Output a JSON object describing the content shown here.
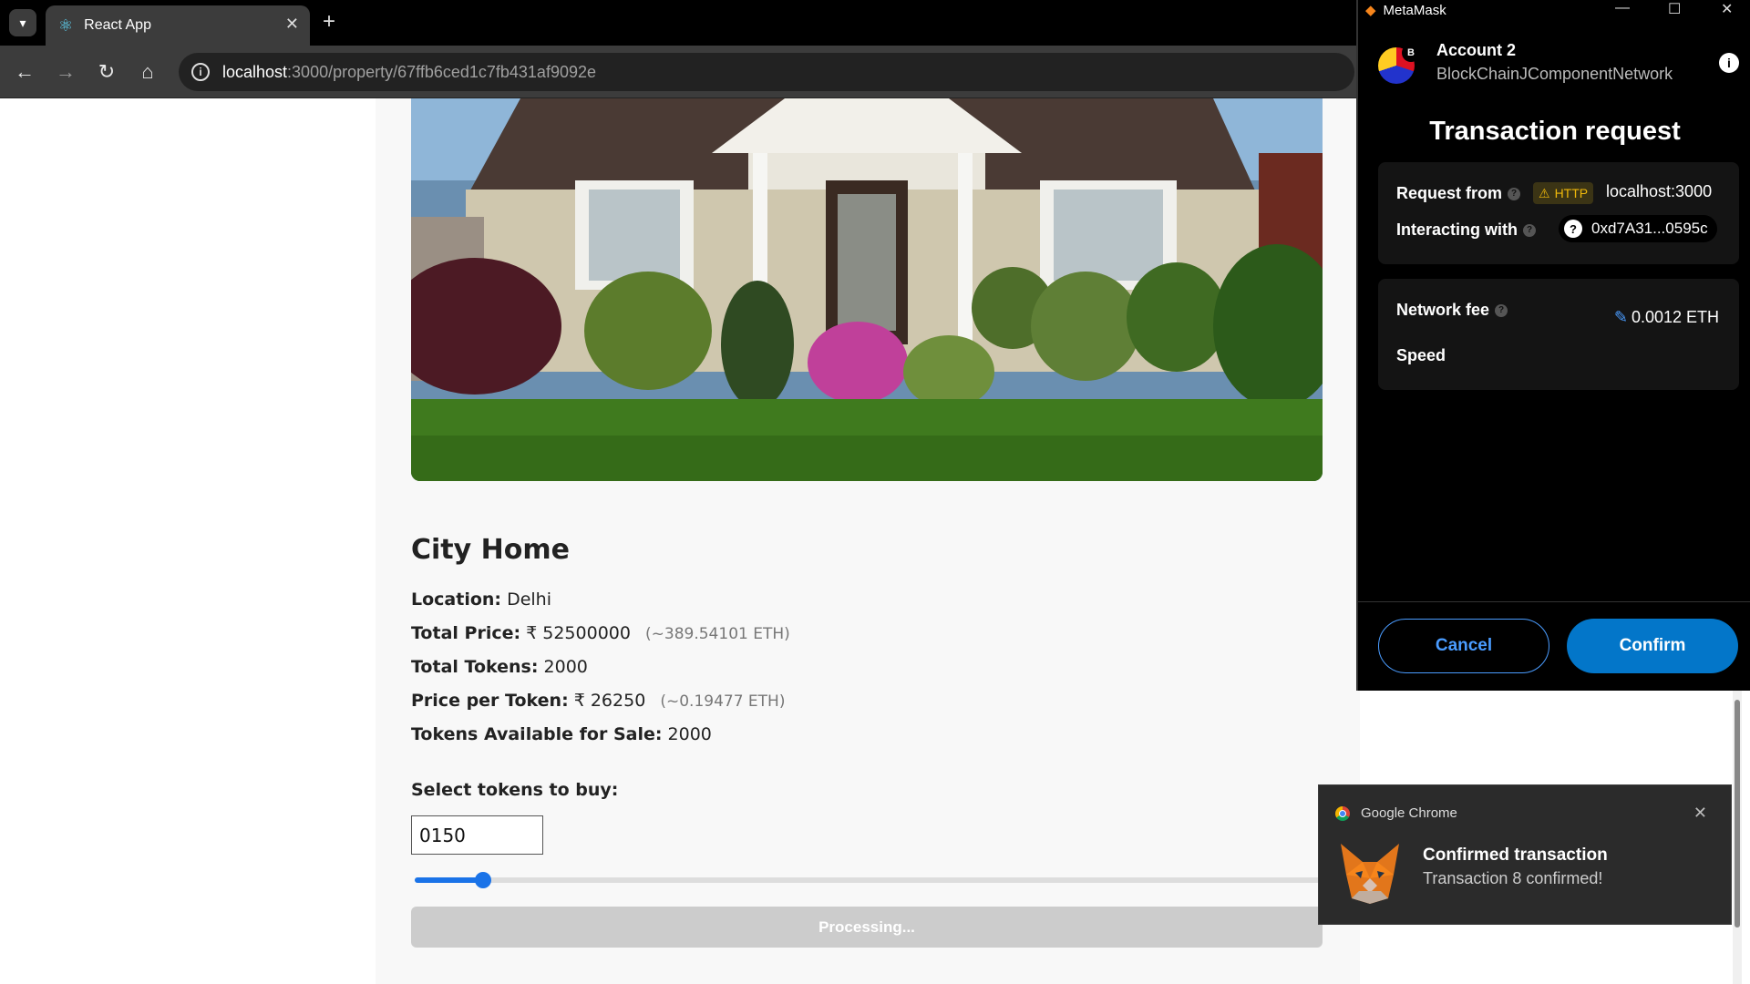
{
  "browser": {
    "tab_title": "React App",
    "url_host": "localhost",
    "url_path": ":3000/property/67ffb6ced1c7fb431af9092e"
  },
  "property": {
    "title": "City Home",
    "location_label": "Location:",
    "location": "Delhi",
    "total_price_label": "Total Price:",
    "total_price": "₹ 52500000",
    "total_price_eth": "(~389.54101 ETH)",
    "total_tokens_label": "Total Tokens:",
    "total_tokens": "2000",
    "price_per_token_label": "Price per Token:",
    "price_per_token": "₹ 26250",
    "price_per_token_eth": "(~0.19477 ETH)",
    "available_label": "Tokens Available for Sale:",
    "available": "2000",
    "select_label": "Select tokens to buy:",
    "token_input_value": "0150",
    "slider_fraction": 0.075,
    "processing_label": "Processing..."
  },
  "metamask": {
    "window_title": "MetaMask",
    "account_name": "Account 2",
    "network": "BlockChainJComponentNetwork",
    "avatar_badge": "B",
    "heading": "Transaction request",
    "request_from_label": "Request from",
    "http_badge": "HTTP",
    "request_host": "localhost:3000",
    "interacting_label": "Interacting with",
    "contract_address": "0xd7A31...0595c",
    "network_fee_label": "Network fee",
    "network_fee": "0.0012 ETH",
    "speed_label": "Speed",
    "cancel_label": "Cancel",
    "confirm_label": "Confirm"
  },
  "notification": {
    "app": "Google Chrome",
    "title": "Confirmed transaction",
    "body": "Transaction 8 confirmed!"
  },
  "colors": {
    "accent": "#1a73e8",
    "metamask_blue": "#0376c9",
    "warning": "#f0b90b"
  }
}
